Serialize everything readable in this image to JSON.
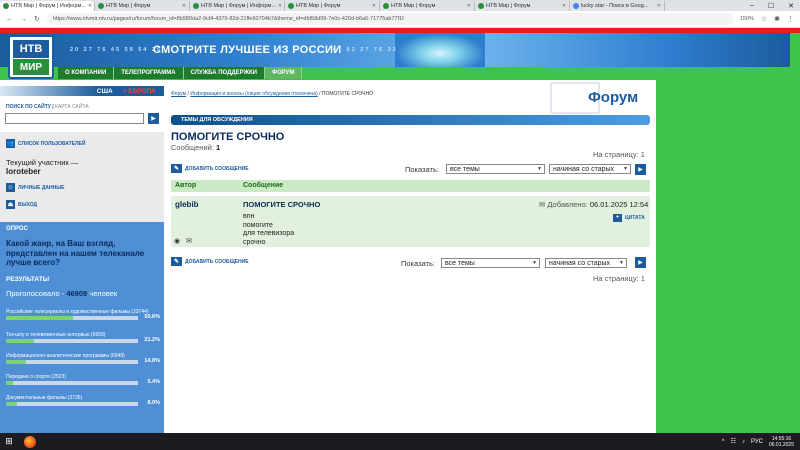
{
  "browser": {
    "tabs": [
      {
        "title": "НТВ Мир | Форум | Информ...",
        "active": true
      },
      {
        "title": "НТВ Мир | Форум",
        "active": false
      },
      {
        "title": "НТВ Мир | Форум | Информ...",
        "active": false
      },
      {
        "title": "НТВ Мир | Форум",
        "active": false
      },
      {
        "title": "НТВ Мир | Форум",
        "active": false
      },
      {
        "title": "НТВ Мир | Форум",
        "active": false
      },
      {
        "title": "lucky star - Поиск в Goog...",
        "active": false
      }
    ],
    "url": "https://www.ntvmir.ntv.ru/pages/ru/forum/forum_id=8b580da2-9cf4-4379-82d-21ffe60704b7&theme_id=dfd58d99-7e0c-420d-b6a5-71775ab77f1f",
    "zoom": "150%"
  },
  "header": {
    "logo_top": "НТВ",
    "logo_bottom": "МИР",
    "slogan": "СМОТРИТЕ ЛУЧШЕЕ ИЗ РОССИИ",
    "numbers_left": "20 27 76 45 59 54 25",
    "numbers_right": "67 82 27 76 33"
  },
  "nav": {
    "items": [
      "О КОМПАНИИ",
      "ТЕЛЕПРОГРАММА",
      "СЛУЖБА ПОДДЕРЖКИ",
      "ФОРУМ"
    ],
    "active_index": 3
  },
  "regions": {
    "usa": "США",
    "europe": "> ЕВРОПА"
  },
  "sidebar": {
    "search_label": "ПОИСК ПО САЙТУ",
    "sitemap_label": "КАРТА САЙТА",
    "users_list": "СПИСОК ПОЛЬЗОВАТЕЛЕЙ",
    "current_label": "Текущий участник —",
    "current_user": "loroteber",
    "profile": "ЛИЧНЫЕ ДАННЫЕ",
    "logout": "ВЫХОД"
  },
  "poll": {
    "heading": "ОПРОС",
    "question": "Какой жанр, на Ваш взгляд, представлен на нашем телеканале лучше всего?",
    "results_heading": "РЕЗУЛЬТАТЫ",
    "votes_label": "Проголосовало -",
    "votes_count": "46909",
    "votes_unit": "человек",
    "options": [
      {
        "label": "Российские телесериалы и художественные фильмы (23744)",
        "percent": "50.6%",
        "value": 50.6
      },
      {
        "label": "Ток-шоу и телевизионные интервью (9959)",
        "percent": "21.2%",
        "value": 21.2
      },
      {
        "label": "Информационно-аналитические программы (6948)",
        "percent": "14.8%",
        "value": 14.8
      },
      {
        "label": "Передачи о спорте (2523)",
        "percent": "5.4%",
        "value": 5.4
      },
      {
        "label": "Документальные фильмы (3735)",
        "percent": "8.0%",
        "value": 8.0
      }
    ]
  },
  "content": {
    "breadcrumb": {
      "forum": "Форум",
      "section": "Информация и анонсы (опция обсуждения отключена)",
      "current": "ПОМОГИТЕ СРОЧНО"
    },
    "page_heading": "Форум",
    "section_bar": "ТЕМЫ ДЛЯ ОБСУЖДЕНИЯ",
    "topic_title": "ПОМОГИТЕ СРОЧНО",
    "messages_label": "Сообщений:",
    "messages_count": "1",
    "per_page_label": "На страницу:",
    "per_page_value": "1",
    "add_message": "ДОБАВИТЬ СООБЩЕНИЕ",
    "show_label": "Показать:",
    "filter_value": "все темы",
    "sort_value": "начиная со старых",
    "col_author": "Автор",
    "col_message": "Сообщение",
    "post": {
      "author": "glebib",
      "title": "ПОМОГИТЕ СРОЧНО",
      "added_label": "Добавлено:",
      "added_date": "06.01.2025 12:54",
      "quote": "ЦИТАТА",
      "body": [
        "впн",
        "помогите",
        "для телевизора",
        "срочно"
      ]
    }
  },
  "taskbar": {
    "lang": "РУС",
    "time": "14:55:16",
    "date": "06.01.2025"
  },
  "colors": {
    "brand_blue": "#1c5b9c",
    "brand_green": "#3ec34c",
    "red": "#e41e1e"
  }
}
